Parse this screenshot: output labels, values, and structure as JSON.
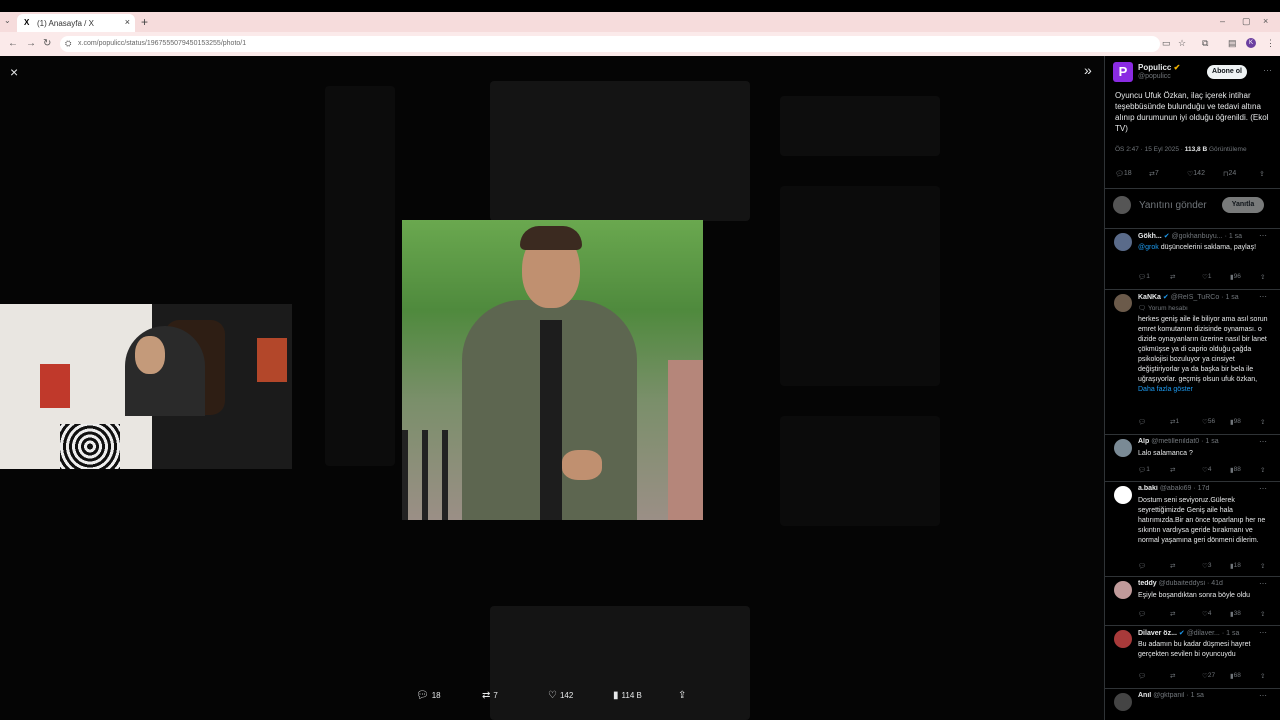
{
  "browser": {
    "tab_title": "(1) Anasayfa / X",
    "url": "x.com/populicc/status/1967555079450153255/photo/1",
    "tab_x": "X",
    "close": "×",
    "new_tab": "+",
    "dropdown": "⌄",
    "minimize": "–",
    "restore": "▢",
    "window_close": "×",
    "back": "←",
    "forward": "→",
    "reload": "↻",
    "tune": "⛭",
    "profile_initial": "K"
  },
  "viewer": {
    "close_icon": "×",
    "expand_icon": "»",
    "stats": {
      "replies": "18",
      "retweets": "7",
      "likes": "142",
      "views": "114 B"
    }
  },
  "tweet": {
    "author_name": "Populicc",
    "author_handle": "@populicc",
    "logo_letter": "P",
    "subscribe_label": "Abone ol",
    "text": "Oyuncu Ufuk Özkan, ilaç içerek intihar teşebbüsünde bulunduğu ve tedavi altına alınıp durumunun iyi olduğu öğrenildi. (Ekol TV)",
    "time": "ÖS 2:47 · 15 Eyl 2025 ·",
    "views_count": "113,8 B",
    "views_label": "Görüntüleme",
    "replies": "18",
    "retweets": "7",
    "likes": "142",
    "bookmarks": "24"
  },
  "reply_box": {
    "placeholder": "Yanıtını gönder",
    "button": "Yanıtla"
  },
  "replies": [
    {
      "name": "Gökh...",
      "handle": "@gokhanbuyu...",
      "time": "· 1 sa",
      "mention": "@grok",
      "text": "düşüncelerini saklama, paylaş!",
      "reply_count": "1",
      "rt_count": "",
      "like_count": "1",
      "views": "96",
      "avatar_color": "#5a6b8a"
    },
    {
      "name": "KaNKa",
      "handle": "@ReIS_TuRCo",
      "time": "· 1 sa",
      "label": "Yorum hesabı",
      "text": "herkes geniş aile ile biliyor ama asıl sorun emret komutanım dizisinde oynaması. o dizide oynayanların üzerine nasıl bir lanet çökmüşse ya di caprio olduğu çağda psikolojisi bozuluyor ya cinsiyet değiştiriyorlar ya da başka bir bela ile uğraşıyorlar. geçmiş olsun ufuk özkan,",
      "show_more": "Daha fazla göster",
      "reply_count": "",
      "rt_count": "1",
      "like_count": "56",
      "views": "98",
      "avatar_color": "#6b5a4a"
    },
    {
      "name": "Alp",
      "handle": "@metillenildat0",
      "time": "· 1 sa",
      "text": "Lalo salamanca ?",
      "reply_count": "1",
      "rt_count": "",
      "like_count": "4",
      "views": "88",
      "avatar_color": "#7a8a95"
    },
    {
      "name": "a.baki",
      "handle": "@abaki69",
      "time": "· 17d",
      "text": "Dostum seni seviyoruz.Gülerek seyrettiğimizde Geniş aile hala hatırımızda.Bir an önce toparlanıp her ne sıkıntın vardıysa geride bırakmanı ve normal yaşamına geri dönmeni dilerim.",
      "reply_count": "",
      "rt_count": "",
      "like_count": "3",
      "views": "18",
      "avatar_color": "#ffffff"
    },
    {
      "name": "teddy",
      "handle": "@dubaiteddysi",
      "time": "· 41d",
      "text": "Eşiyle boşandıktan sonra böyle oldu",
      "reply_count": "",
      "rt_count": "",
      "like_count": "4",
      "views": "38",
      "avatar_color": "#c09a9a"
    },
    {
      "name": "Dilaver öz...",
      "handle": "@dilaver...",
      "time": "· 1 sa",
      "text": "Bu adamın bu kadar düşmesi hayret gerçekten sevilen bi oyuncuydu",
      "reply_count": "",
      "rt_count": "",
      "like_count": "27",
      "views": "68",
      "avatar_color": "#a83a3a"
    },
    {
      "name": "Anıl",
      "handle": "@gktpanil",
      "time": "· 1 sa",
      "avatar_color": "#444444"
    }
  ]
}
